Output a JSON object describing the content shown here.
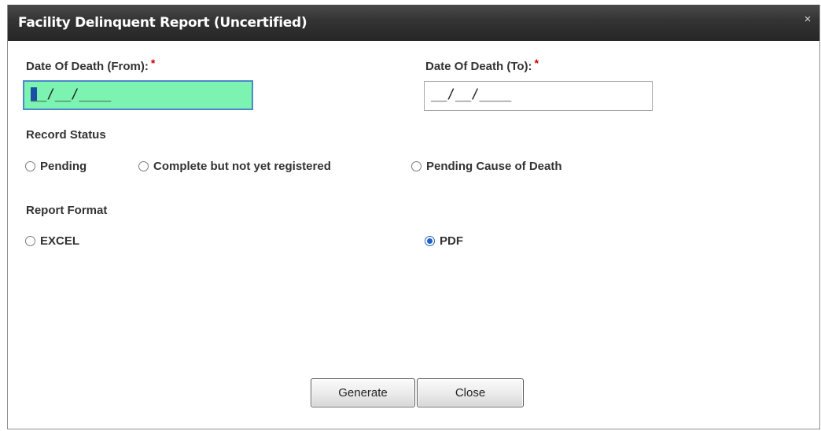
{
  "dialog": {
    "title": "Facility Delinquent Report (Uncertified)",
    "close_glyph": "×"
  },
  "fields": {
    "date_from": {
      "label": "Date Of Death (From):",
      "required": "*",
      "value": "__/__/____",
      "focused": true,
      "bg_color": "#7df3b1"
    },
    "date_to": {
      "label": "Date Of Death (To):",
      "required": "*",
      "value": "__/__/____"
    }
  },
  "record_status": {
    "label": "Record Status",
    "options": [
      {
        "label": "Pending",
        "checked": false
      },
      {
        "label": "Complete but not yet registered",
        "checked": false
      },
      {
        "label": "Pending Cause of Death",
        "checked": false
      }
    ]
  },
  "report_format": {
    "label": "Report Format",
    "options": [
      {
        "label": "EXCEL",
        "checked": false
      },
      {
        "label": "PDF",
        "checked": true
      }
    ]
  },
  "buttons": {
    "generate": "Generate",
    "close": "Close"
  },
  "colors": {
    "titlebar": "#333333",
    "required": "#cc0000",
    "focus_border": "#4d88c9",
    "radio_checked": "#1e5fc6"
  }
}
